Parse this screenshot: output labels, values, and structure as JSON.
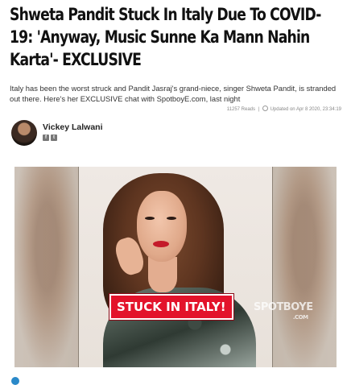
{
  "article": {
    "headline": "Shweta Pandit Stuck In Italy Due To COVID-19: 'Anyway, Music Sunne Ka Mann Nahin Karta'- EXCLUSIVE",
    "summary": "Italy has been the worst struck and Pandit Jasraj's grand-niece, singer Shweta Pandit, is stranded out there. Here's her EXCLUSIVE chat with SpotboyE.com, last night",
    "reads": "11257 Reads",
    "separator": "|",
    "updated": "Updated on Apr 8 2020, 23:34:19"
  },
  "author": {
    "name": "Vickey Lalwani",
    "social_icons": [
      "facebook-icon",
      "twitter-icon"
    ]
  },
  "hero": {
    "stamp_text": "STUCK IN ITALY!",
    "watermark": "SPOTBOYE",
    "watermark_sub": ".COM"
  }
}
